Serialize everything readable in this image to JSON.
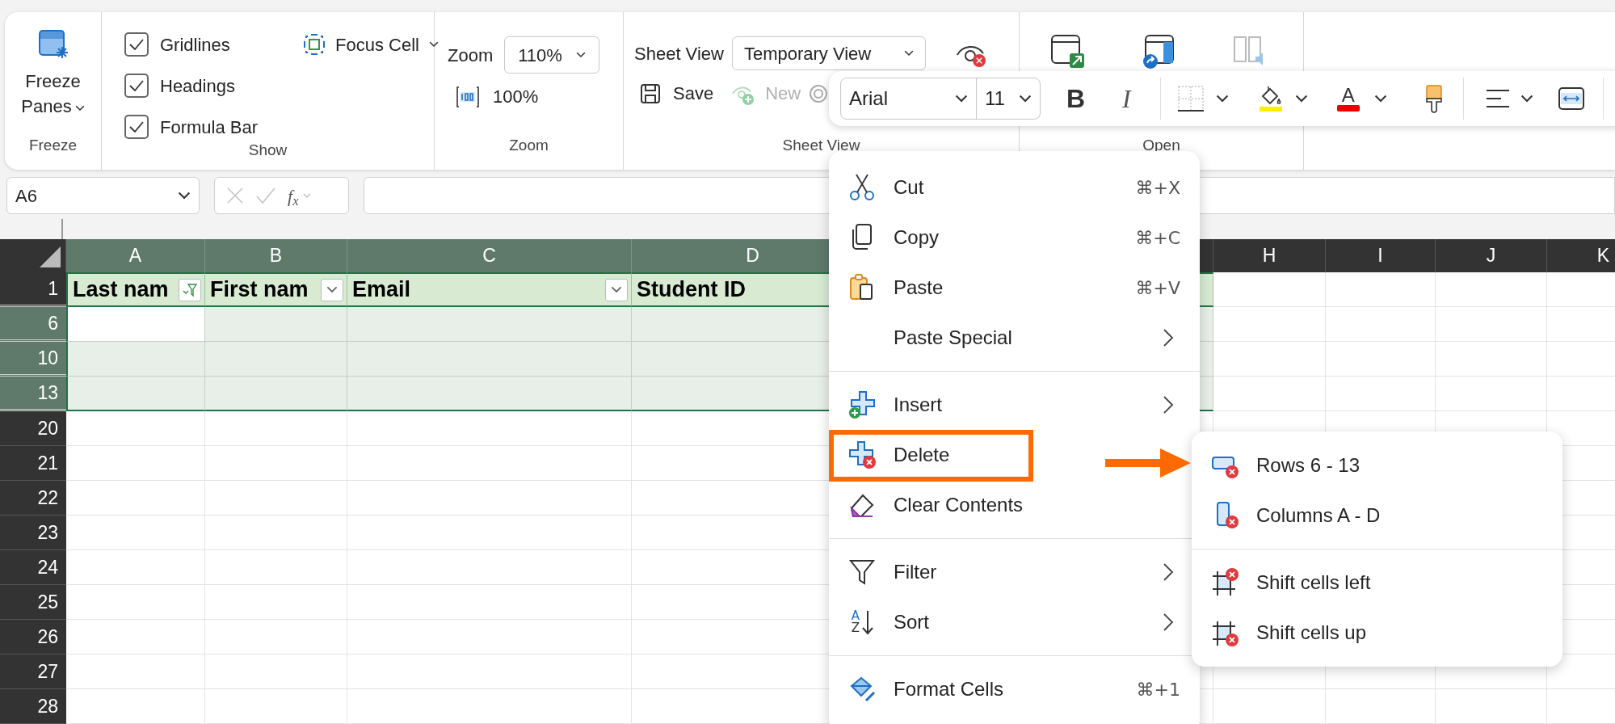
{
  "ribbon": {
    "freeze": {
      "button": "Freeze Panes",
      "group_label": "Freeze"
    },
    "show": {
      "checkboxes": [
        {
          "label": "Gridlines",
          "checked": true
        },
        {
          "label": "Headings",
          "checked": true
        },
        {
          "label": "Formula Bar",
          "checked": true
        }
      ],
      "focus_cell": "Focus Cell",
      "group_label": "Show"
    },
    "zoom": {
      "label": "Zoom",
      "value": "110%",
      "reset": "100%",
      "group_label": "Zoom"
    },
    "sheet_view": {
      "label": "Sheet View",
      "value": "Temporary View",
      "buttons": [
        {
          "label": "Save",
          "disabled": false
        },
        {
          "label": "New",
          "disabled": true
        }
      ],
      "group_label": "Sheet View"
    },
    "open": {
      "group_label": "Open"
    }
  },
  "mini_toolbar": {
    "font": "Arial",
    "size": "11",
    "bold": "B",
    "italic": "I",
    "font_color": "A"
  },
  "formula_bar": {
    "name_box": "A6",
    "function_button": "f$_{x}$"
  },
  "grid": {
    "columns": [
      {
        "label": "A",
        "selected": true
      },
      {
        "label": "B",
        "selected": true
      },
      {
        "label": "C",
        "selected": true
      },
      {
        "label": "D",
        "selected": true
      },
      {
        "label": "H",
        "selected": false
      },
      {
        "label": "I",
        "selected": false
      },
      {
        "label": "J",
        "selected": false
      },
      {
        "label": "K",
        "selected": false
      }
    ],
    "rows": [
      {
        "label": "1",
        "selected": false,
        "cells": [
          {
            "kind": "filtered",
            "text": "Last nam"
          },
          {
            "kind": "dropdown",
            "text": "First nam"
          },
          {
            "kind": "dropdown",
            "text": "Email"
          },
          {
            "kind": "plain",
            "text": "Student ID"
          }
        ]
      },
      {
        "label": "6",
        "selected": true,
        "active": true
      },
      {
        "label": "10",
        "selected": true
      },
      {
        "label": "13",
        "selected": true
      },
      {
        "label": "20",
        "selected": false
      },
      {
        "label": "21",
        "selected": false
      },
      {
        "label": "22",
        "selected": false
      },
      {
        "label": "23",
        "selected": false
      },
      {
        "label": "24",
        "selected": false
      },
      {
        "label": "25",
        "selected": false
      },
      {
        "label": "26",
        "selected": false
      },
      {
        "label": "27",
        "selected": false
      },
      {
        "label": "28",
        "selected": false
      }
    ]
  },
  "context_menu": {
    "items": [
      {
        "kind": "item",
        "label": "Cut",
        "shortcut": "⌘+X"
      },
      {
        "kind": "item",
        "label": "Copy",
        "shortcut": "⌘+C"
      },
      {
        "kind": "item",
        "label": "Paste",
        "shortcut": "⌘+V"
      },
      {
        "kind": "item",
        "label": "Paste Special",
        "has_submenu": true
      },
      {
        "kind": "separator"
      },
      {
        "kind": "item",
        "label": "Insert",
        "has_submenu": true
      },
      {
        "kind": "item",
        "label": "Delete",
        "highlighted": true
      },
      {
        "kind": "item",
        "label": "Clear Contents"
      },
      {
        "kind": "separator"
      },
      {
        "kind": "item",
        "label": "Filter",
        "has_submenu": true
      },
      {
        "kind": "item",
        "label": "Sort",
        "has_submenu": true,
        "icon_letters": [
          "A",
          "Z"
        ]
      },
      {
        "kind": "separator"
      },
      {
        "kind": "item",
        "label": "Format Cells",
        "shortcut": "⌘+1"
      }
    ]
  },
  "submenu": {
    "items": [
      {
        "kind": "item",
        "label": "Rows 6 - 13"
      },
      {
        "kind": "item",
        "label": "Columns A - D"
      },
      {
        "kind": "separator"
      },
      {
        "kind": "item",
        "label": "Shift cells left"
      },
      {
        "kind": "item",
        "label": "Shift cells up"
      }
    ]
  }
}
